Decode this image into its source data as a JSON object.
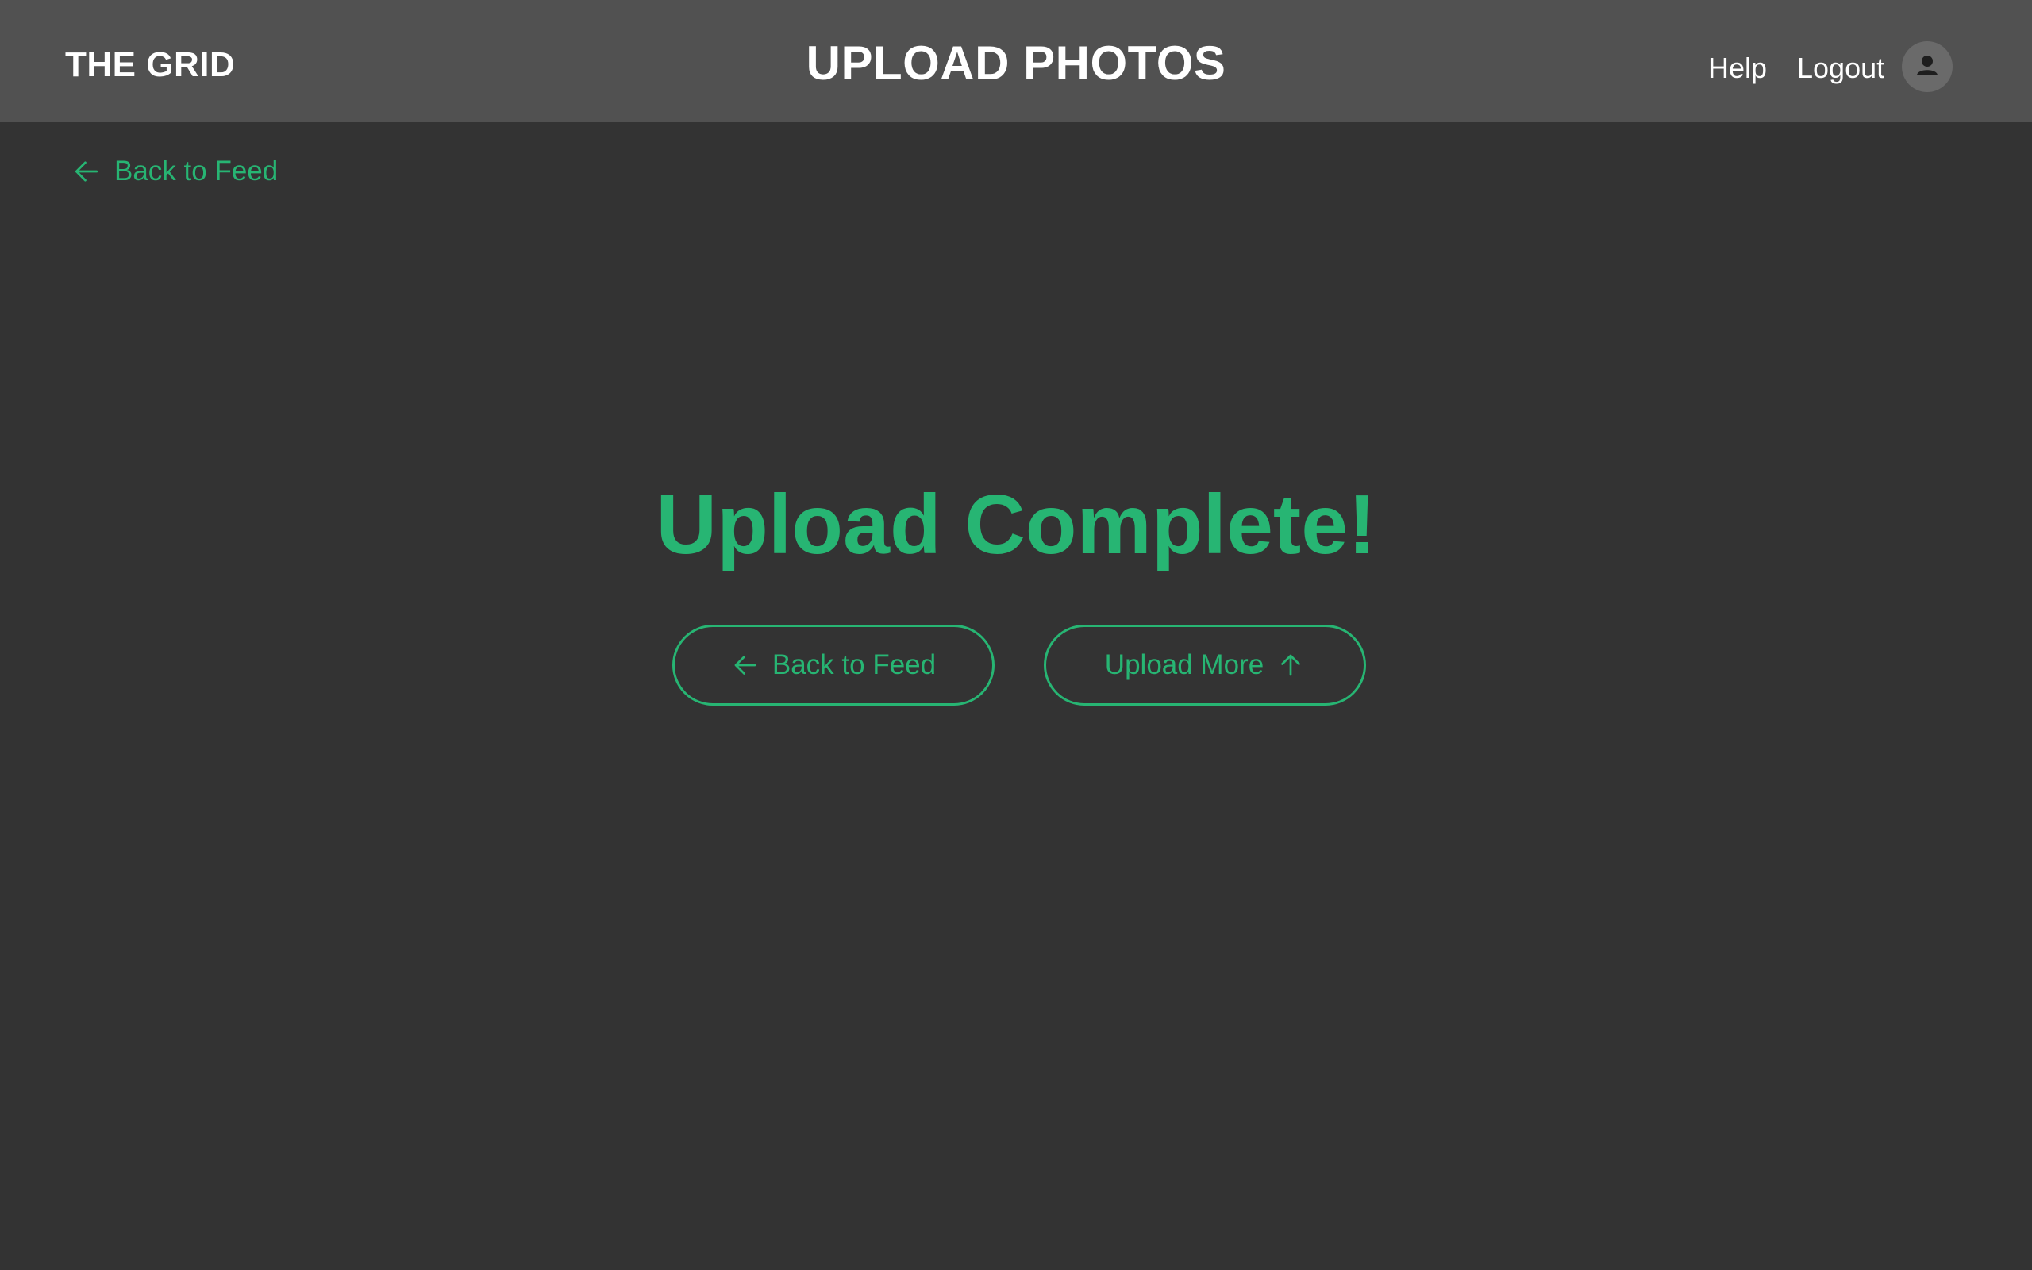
{
  "header": {
    "logo": "THE GRID",
    "title": "UPLOAD PHOTOS",
    "nav": {
      "help": "Help",
      "logout": "Logout"
    },
    "avatar_icon": "user-silhouette-icon"
  },
  "main": {
    "back_link": {
      "label": "Back to Feed",
      "icon": "arrow-left-icon"
    },
    "headline": "Upload Complete!",
    "buttons": {
      "back": {
        "label": "Back to Feed",
        "icon": "arrow-left-icon"
      },
      "upload_more": {
        "label": "Upload More",
        "icon": "arrow-up-icon"
      }
    }
  },
  "colors": {
    "background": "#333333",
    "header_background": "#515151",
    "accent": "#27b573",
    "header_text": "#ffffff",
    "avatar_background": "#6a6a6a"
  }
}
